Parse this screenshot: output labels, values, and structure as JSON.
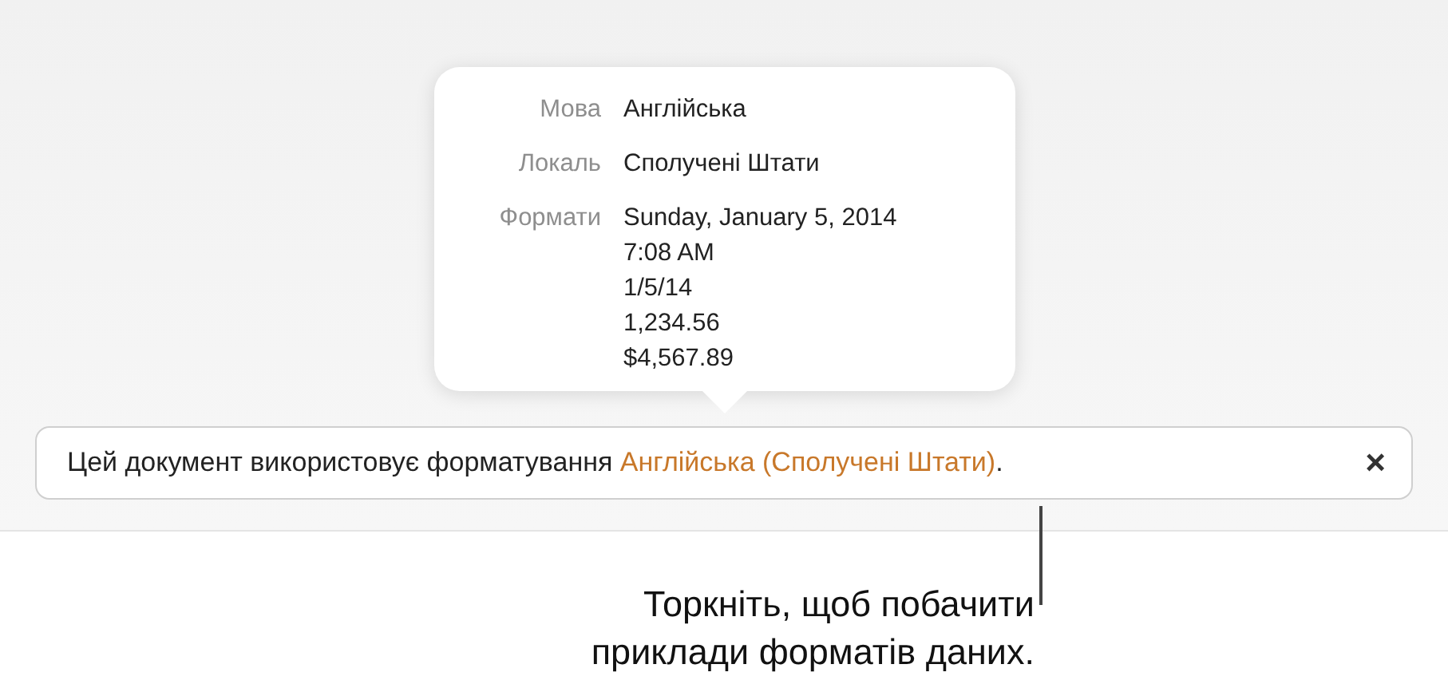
{
  "popover": {
    "rows": [
      {
        "label": "Мова",
        "values": [
          "Англійська"
        ]
      },
      {
        "label": "Локаль",
        "values": [
          "Сполучені Штати"
        ]
      },
      {
        "label": "Формати",
        "values": [
          "Sunday, January 5, 2014",
          "7:08 AM",
          "1/5/14",
          "1,234.56",
          "$4,567.89"
        ]
      }
    ]
  },
  "banner": {
    "text": "Цей документ використовує форматування",
    "link": "Англійська (Сполучені Штати)",
    "end": ".",
    "close": "×"
  },
  "callout": {
    "lines": [
      "Торкніть, щоб побачити",
      "приклади форматів даних."
    ]
  }
}
